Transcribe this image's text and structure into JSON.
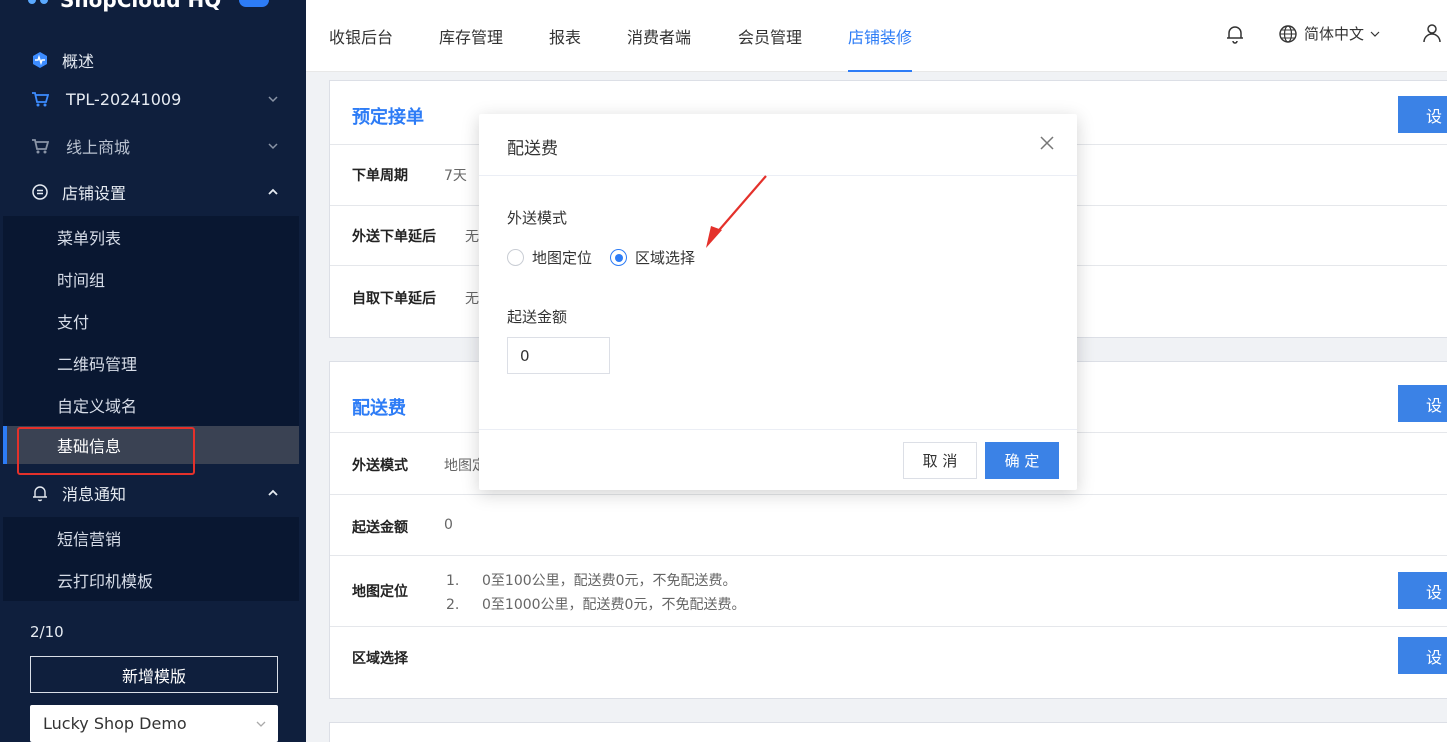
{
  "brand": {
    "name": "ShopCloud HQ"
  },
  "sidebar": {
    "items": [
      {
        "label": "概述",
        "icon": "dashboard-icon"
      },
      {
        "label": "TPL-20241009",
        "icon": "cart-icon"
      },
      {
        "label": "线上商城",
        "icon": "cart-icon"
      },
      {
        "label": "店铺设置",
        "icon": "settings-circle-icon"
      },
      {
        "label": "消息通知",
        "icon": "bell-icon"
      }
    ],
    "store_settings_sub": [
      "菜单列表",
      "时间组",
      "支付",
      "二维码管理",
      "自定义域名",
      "基础信息"
    ],
    "notify_sub": [
      "短信营销",
      "云打印机模板"
    ],
    "page_count": "2/10",
    "new_template_label": "新增模版",
    "shop_select_value": "Lucky Shop Demo"
  },
  "topbar": {
    "tabs": [
      "收银后台",
      "库存管理",
      "报表",
      "消费者端",
      "会员管理",
      "店铺装修"
    ],
    "active_tab": "店铺装修",
    "language": "简体中文"
  },
  "main": {
    "preorder_card": {
      "title": "预定接单",
      "set_label": "设",
      "rows": [
        {
          "label": "下单周期",
          "value": "7天"
        },
        {
          "label": "外送下单延后",
          "value": "无"
        },
        {
          "label": "自取下单延后",
          "value": "无"
        }
      ]
    },
    "delivery_card": {
      "title": "配送费",
      "set_label": "设",
      "rows": [
        {
          "label": "外送模式",
          "value": "地图定"
        },
        {
          "label": "起送金额",
          "value": "0"
        },
        {
          "label": "地图定位",
          "list": [
            "0至100公里，配送费0元，不免配送费。",
            "0至1000公里，配送费0元，不免配送费。"
          ]
        },
        {
          "label": "区域选择",
          "value": ""
        }
      ]
    }
  },
  "modal": {
    "title": "配送费",
    "mode_label": "外送模式",
    "options": [
      "地图定位",
      "区域选择"
    ],
    "selected_option": "区域选择",
    "min_amount_label": "起送金额",
    "min_amount_value": "0",
    "cancel_label": "取 消",
    "ok_label": "确 定"
  },
  "colors": {
    "accent": "#2d7cf6",
    "sidebar_bg": "#0f1f3d",
    "highlight_red": "#e4312b"
  }
}
